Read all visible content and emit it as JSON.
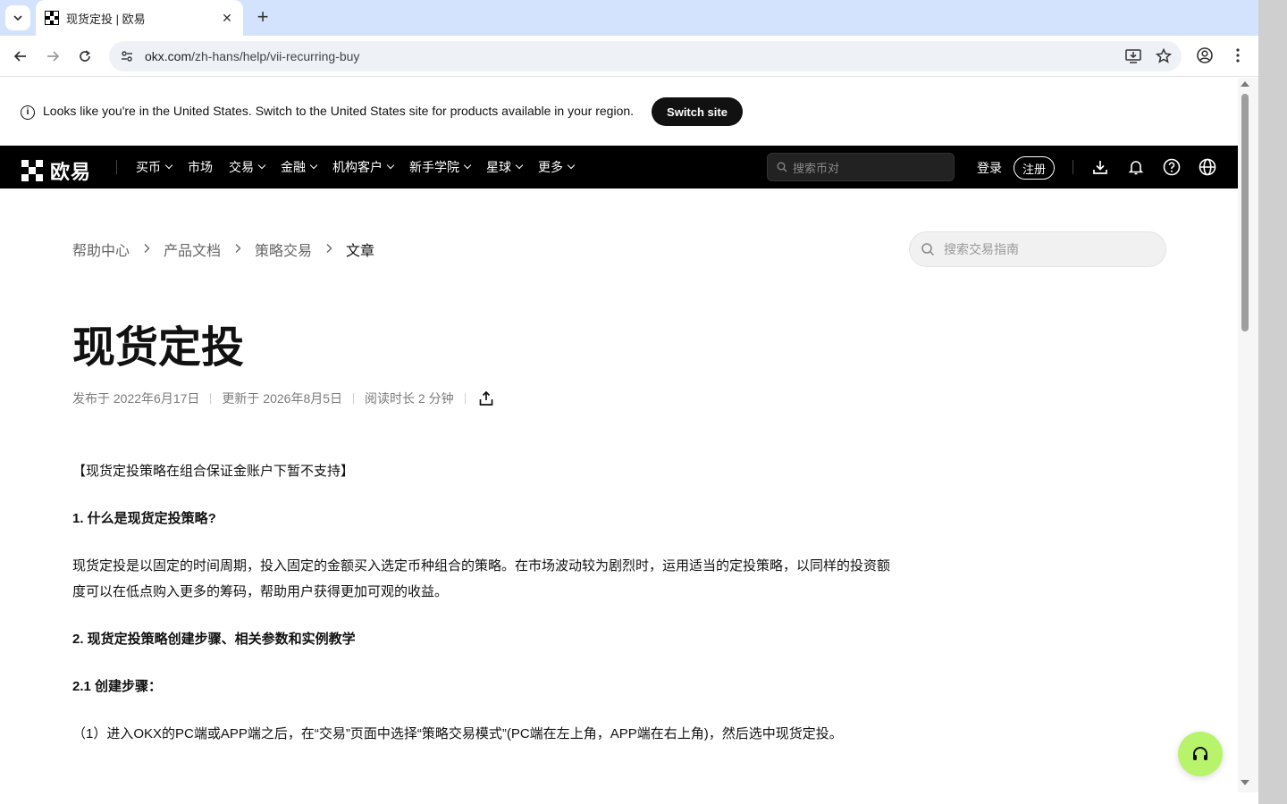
{
  "browser": {
    "tab_title": "现货定投 | 欧易",
    "tab_close": "✕",
    "new_tab": "+",
    "url_host": "okx.com",
    "url_path": "/zh-hans/help/vii-recurring-buy"
  },
  "banner": {
    "text": "Looks like you're in the United States. Switch to the United States site for products available in your region.",
    "button": "Switch site"
  },
  "nav": {
    "logo": "欧易",
    "items": [
      {
        "label": "买币",
        "dropdown": true
      },
      {
        "label": "市场",
        "dropdown": false
      },
      {
        "label": "交易",
        "dropdown": true
      },
      {
        "label": "金融",
        "dropdown": true
      },
      {
        "label": "机构客户",
        "dropdown": true
      },
      {
        "label": "新手学院",
        "dropdown": true
      },
      {
        "label": "星球",
        "dropdown": true
      },
      {
        "label": "更多",
        "dropdown": true
      }
    ],
    "search_placeholder": "搜索币对",
    "login": "登录",
    "register": "注册"
  },
  "breadcrumb": {
    "items": [
      "帮助中心",
      "产品文档",
      "策略交易"
    ],
    "current": "文章"
  },
  "help_search_placeholder": "搜索交易指南",
  "article": {
    "title": "现货定投",
    "published": "发布于 2022年6月17日",
    "updated": "更新于 2026年8月5日",
    "read_time": "阅读时长 2 分钟",
    "paragraphs": [
      {
        "text": "【现货定投策略在组合保证金账户下暂不支持】",
        "bold": false
      },
      {
        "text": "1. 什么是现货定投策略?",
        "bold": true
      },
      {
        "text": "现货定投是以固定的时间周期，投入固定的金额买入选定币种组合的策略。在市场波动较为剧烈时，运用适当的定投策略，以同样的投资额度可以在低点购入更多的筹码，帮助用户获得更加可观的收益。",
        "bold": false
      },
      {
        "text": "2. 现货定投策略创建步骤、相关参数和实例教学",
        "bold": true
      },
      {
        "text": "2.1 创建步骤：",
        "bold": true
      },
      {
        "text": "（1）进入OKX的PC端或APP端之后，在“交易”页面中选择“策略交易模式”(PC端在左上角，APP端在右上角)，然后选中现货定投。",
        "bold": false
      }
    ]
  }
}
